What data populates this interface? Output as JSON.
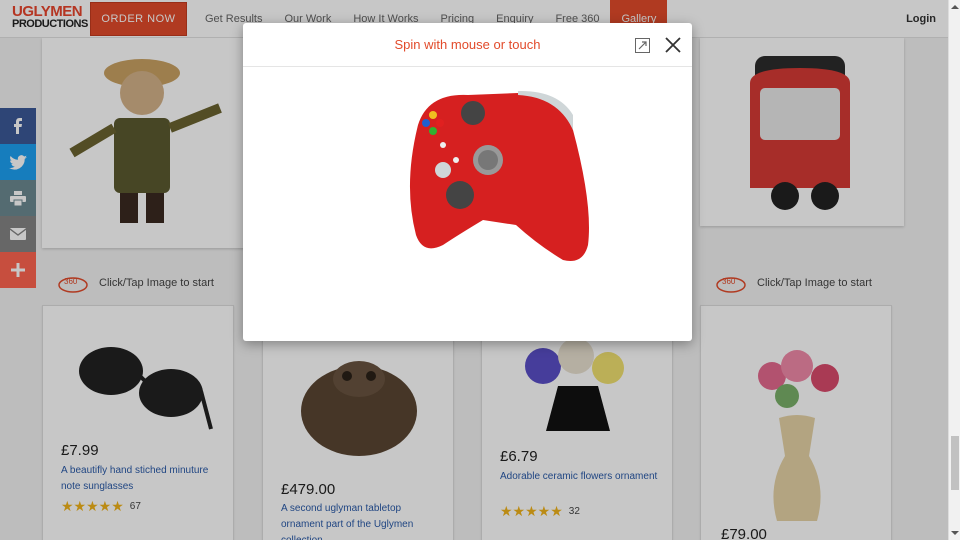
{
  "header": {
    "logo_line1": "UGLYMEN",
    "logo_line2": "PRODUCTIONS",
    "order_button": "ORDER NOW",
    "nav": [
      "Get Results",
      "Our Work",
      "How It Works",
      "Pricing",
      "Enquiry",
      "Free 360",
      "Gallery"
    ],
    "active_nav": "Gallery",
    "login": "Login"
  },
  "social": [
    {
      "icon": "facebook-icon",
      "color": "#3b5998"
    },
    {
      "icon": "twitter-icon",
      "color": "#1da1f2"
    },
    {
      "icon": "print-icon",
      "color": "#6c8a91"
    },
    {
      "icon": "email-icon",
      "color": "#848484"
    },
    {
      "icon": "share-plus-icon",
      "color": "#ff6550"
    }
  ],
  "gallery": {
    "hint_text": "Click/Tap Image to start",
    "products": [
      {
        "price": "£7.99",
        "description": "A beautifly hand stiched minuture note sunglasses",
        "rating_count": "67"
      },
      {
        "price": "£479.00",
        "description": "A second uglyman tabletop ornament part of the Uglymen collection",
        "rating_count": ""
      },
      {
        "price": "£6.79",
        "description": "Adorable ceramic flowers ornament",
        "rating_count": "32"
      },
      {
        "price": "£79.00",
        "description": "",
        "rating_count": ""
      }
    ]
  },
  "modal": {
    "title": "Spin with mouse or touch"
  },
  "colors": {
    "brand": "#e24b2b",
    "link": "#2a5aa8",
    "star": "#f0b21a"
  }
}
